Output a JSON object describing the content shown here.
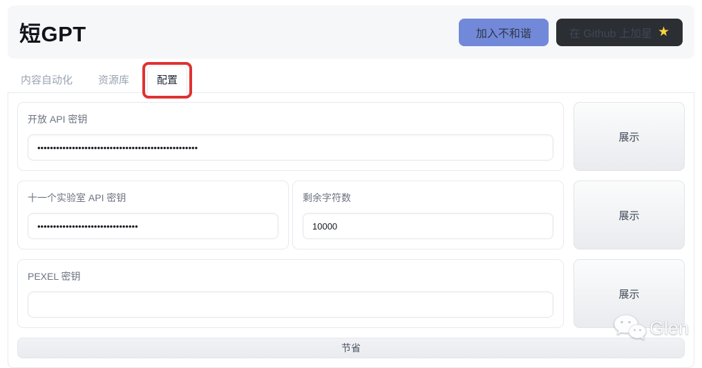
{
  "header": {
    "title": "短GPT",
    "discord_button": "加入不和谐",
    "github_button": "在 Github 上加星",
    "github_star_icon": "★"
  },
  "tabs": [
    {
      "label": "内容自动化",
      "active": false
    },
    {
      "label": "资源库",
      "active": false
    },
    {
      "label": "配置",
      "active": true,
      "annotation": "red-highlight-box"
    }
  ],
  "form": {
    "rows": [
      {
        "fields": [
          {
            "label": "开放 API 密钥",
            "value": "•••••••••••••••••••••••••••••••••••••••••••••••••••",
            "type": "password"
          }
        ],
        "action": "展示"
      },
      {
        "fields": [
          {
            "label": "十一个实验室 API 密钥",
            "value": "••••••••••••••••••••••••••••••••",
            "type": "password"
          },
          {
            "label": "剩余字符数",
            "value": "10000",
            "type": "number"
          }
        ],
        "action": "展示"
      },
      {
        "fields": [
          {
            "label": "PEXEL 密钥",
            "value": "",
            "type": "text"
          }
        ],
        "action": "展示"
      }
    ],
    "save_label": "节省"
  },
  "watermark": {
    "text": "Glen",
    "icon": "wechat-logo"
  },
  "colors": {
    "discord_button_bg": "#7289da",
    "github_button_bg": "#2b2e33",
    "star_gold": "#ffd43b",
    "annotation_red": "#e03131",
    "header_bg": "#f6f7f9",
    "border_gray": "#e7e9ed"
  }
}
